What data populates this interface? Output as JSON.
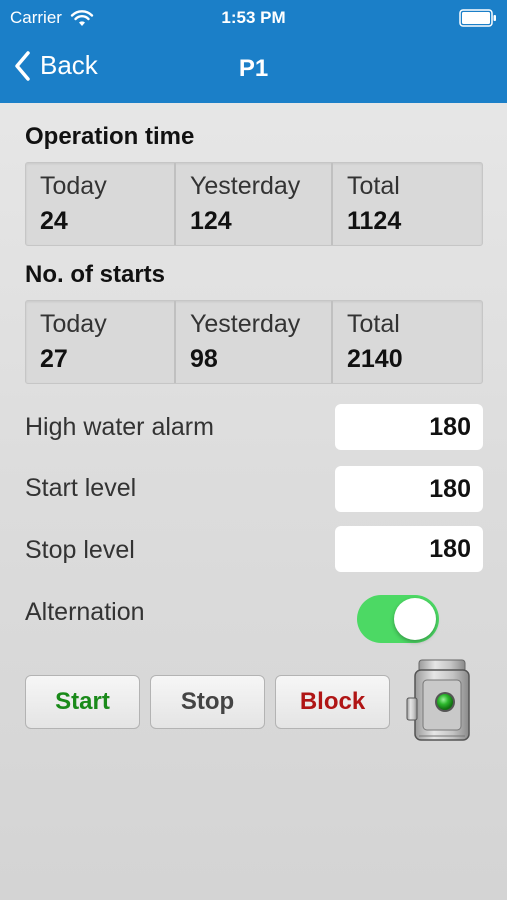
{
  "status_bar": {
    "carrier": "Carrier",
    "time": "1:53 PM"
  },
  "nav": {
    "back_label": "Back",
    "title": "P1"
  },
  "operation_time": {
    "title": "Operation time",
    "cells": [
      {
        "label": "Today",
        "value": "24"
      },
      {
        "label": "Yesterday",
        "value": "124"
      },
      {
        "label": "Total",
        "value": "1124"
      }
    ]
  },
  "starts": {
    "title": "No. of starts",
    "cells": [
      {
        "label": "Today",
        "value": "27"
      },
      {
        "label": "Yesterday",
        "value": "98"
      },
      {
        "label": "Total",
        "value": "2140"
      }
    ]
  },
  "settings": {
    "high_water_alarm": {
      "label": "High water alarm",
      "value": "180"
    },
    "start_level": {
      "label": "Start level",
      "value": "180"
    },
    "stop_level": {
      "label": "Stop level",
      "value": "180"
    },
    "alternation": {
      "label": "Alternation",
      "enabled": true
    }
  },
  "actions": {
    "start": "Start",
    "stop": "Stop",
    "block": "Block"
  },
  "pump_status": {
    "state": "running",
    "indicator_color": "#2db82d"
  },
  "colors": {
    "header": "#1b7fc8",
    "toggle_on": "#4cd964",
    "start_text": "#1a8a1a",
    "block_text": "#b01515"
  }
}
